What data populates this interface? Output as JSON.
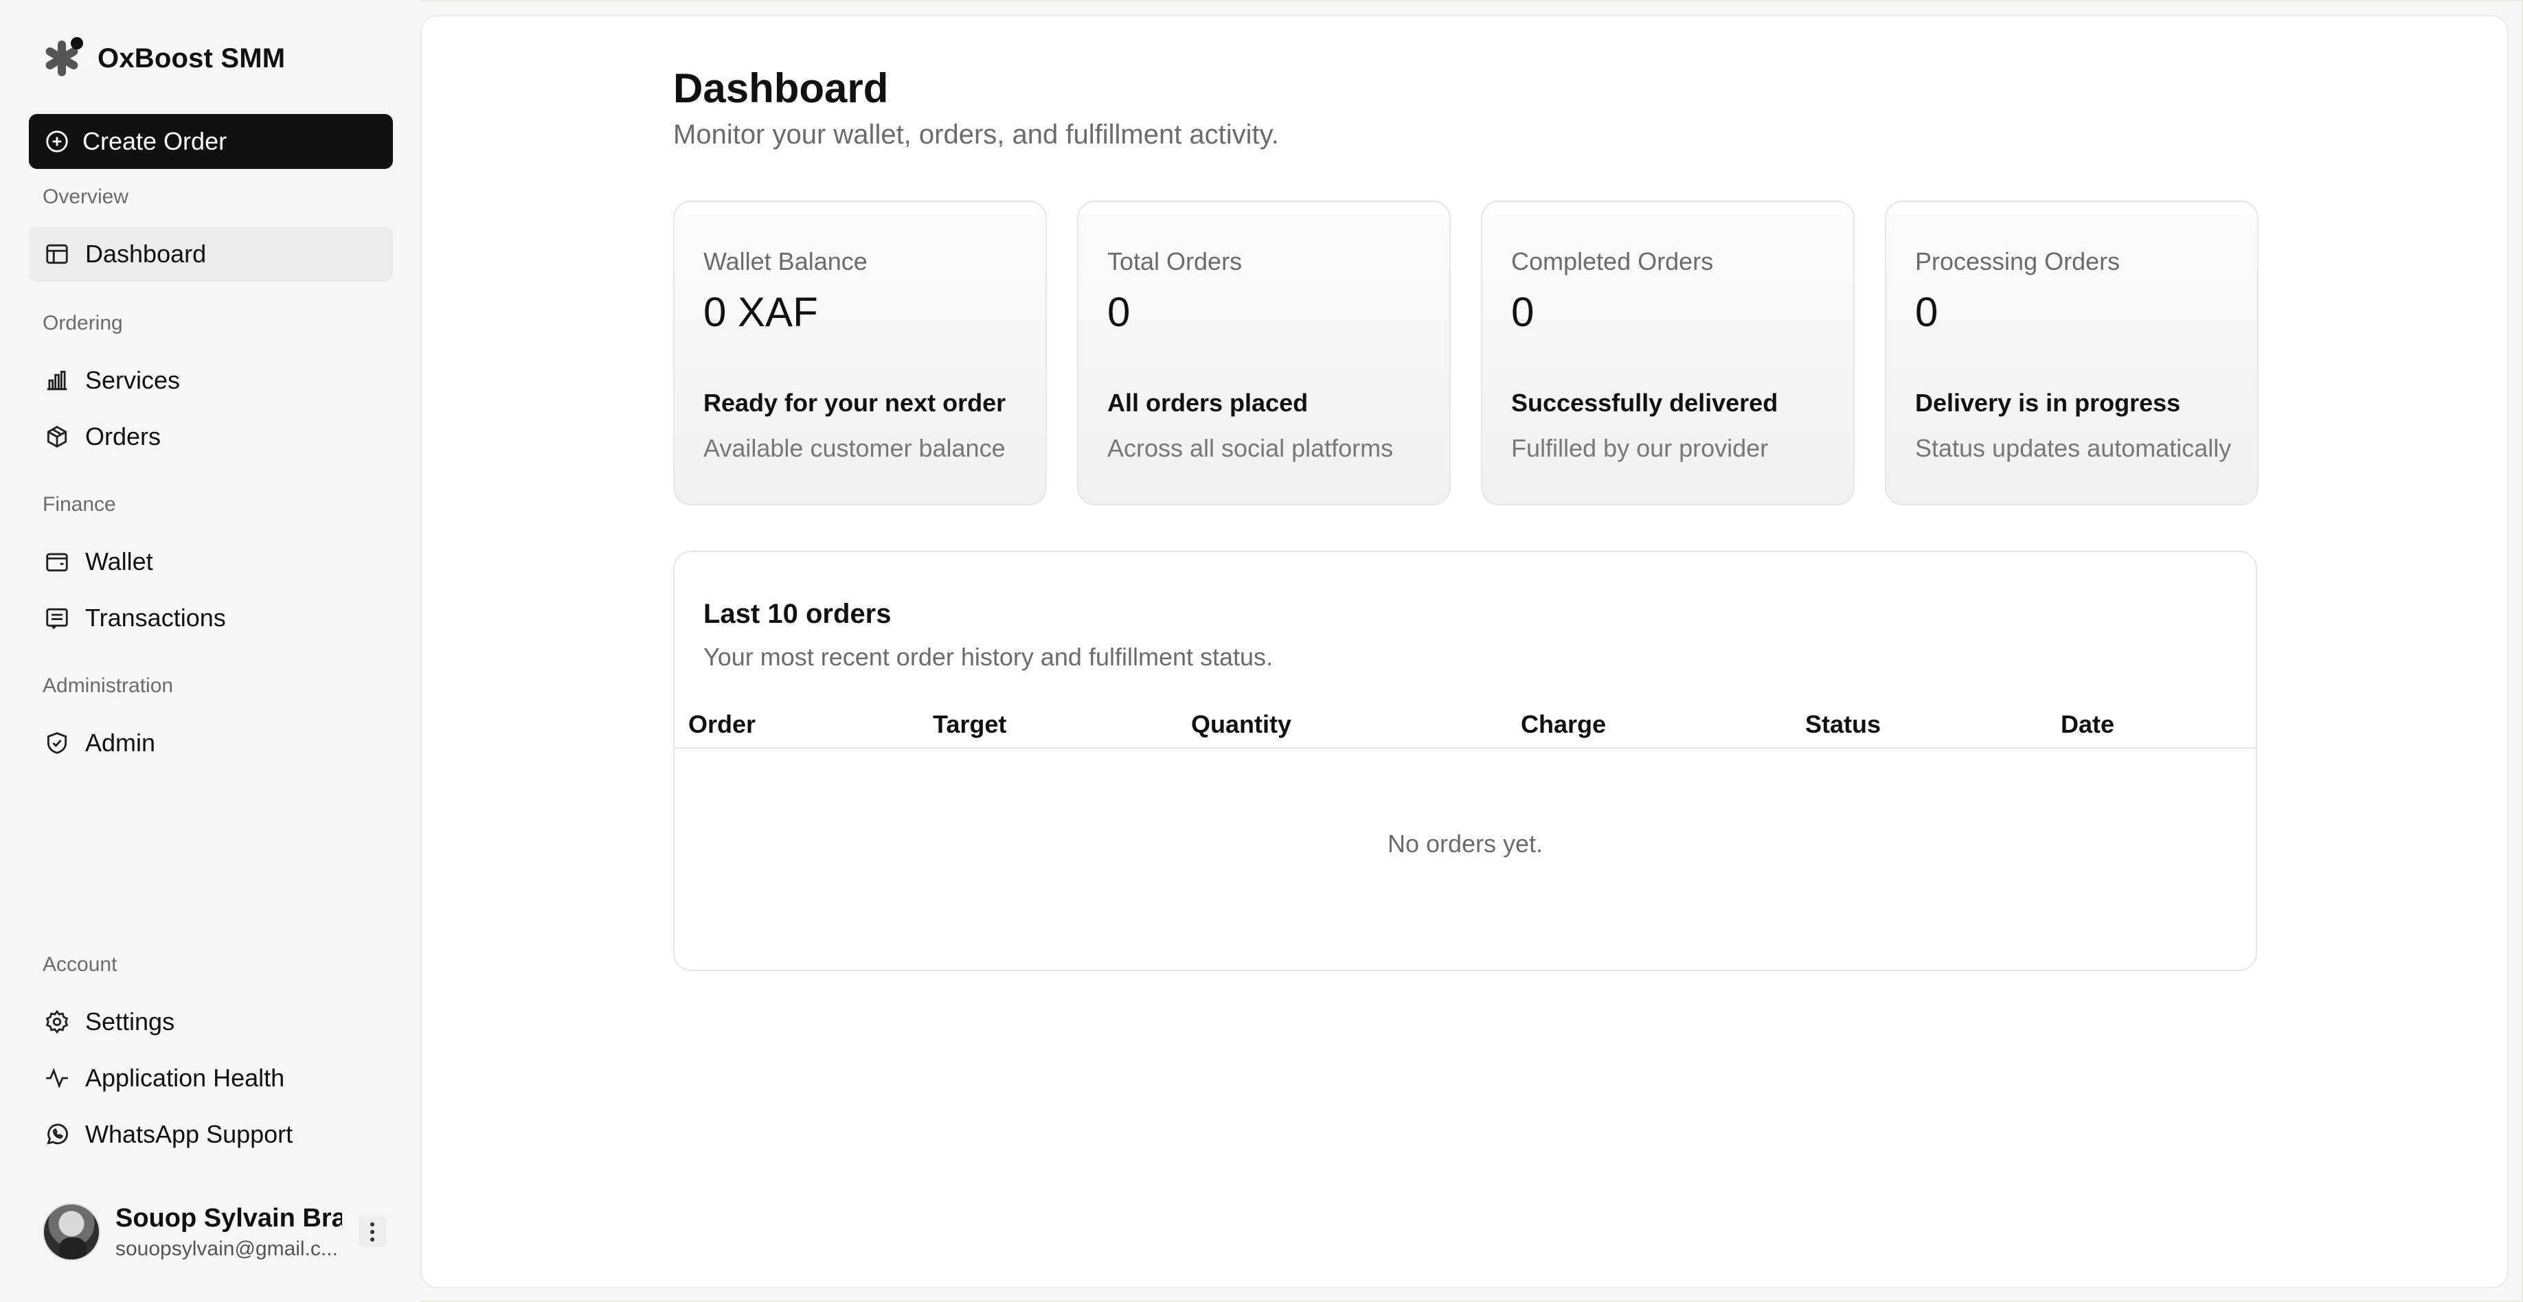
{
  "brand": {
    "name": "OxBoost SMM",
    "logo_icon": "asterisk-logo-icon"
  },
  "sidebar": {
    "create_order": {
      "label": "Create Order",
      "icon": "plus-circle-icon"
    },
    "sections": {
      "overview": "Overview",
      "ordering": "Ordering",
      "finance": "Finance",
      "administration": "Administration",
      "account": "Account"
    },
    "items": {
      "dashboard": {
        "label": "Dashboard",
        "icon": "layout-icon",
        "active": true
      },
      "services": {
        "label": "Services",
        "icon": "bar-chart-icon"
      },
      "orders": {
        "label": "Orders",
        "icon": "package-icon"
      },
      "wallet": {
        "label": "Wallet",
        "icon": "wallet-icon"
      },
      "transactions": {
        "label": "Transactions",
        "icon": "receipt-icon"
      },
      "admin": {
        "label": "Admin",
        "icon": "shield-check-icon"
      },
      "settings": {
        "label": "Settings",
        "icon": "gear-icon"
      },
      "health": {
        "label": "Application Health",
        "icon": "activity-icon"
      },
      "whatsapp": {
        "label": "WhatsApp Support",
        "icon": "whatsapp-icon"
      }
    },
    "user": {
      "name": "Souop Sylvain Bra...",
      "email": "souopsylvain@gmail.c..."
    }
  },
  "main": {
    "title": "Dashboard",
    "subtitle": "Monitor your wallet, orders, and fulfillment activity.",
    "cards": [
      {
        "label": "Wallet Balance",
        "value": "0 XAF",
        "headline": "Ready for your next order",
        "desc": "Available customer balance"
      },
      {
        "label": "Total Orders",
        "value": "0",
        "headline": "All orders placed",
        "desc": "Across all social platforms"
      },
      {
        "label": "Completed Orders",
        "value": "0",
        "headline": "Successfully delivered",
        "desc": "Fulfilled by our provider"
      },
      {
        "label": "Processing Orders",
        "value": "0",
        "headline": "Delivery is in progress",
        "desc": "Status updates automatically"
      }
    ],
    "orders": {
      "title": "Last 10 orders",
      "subtitle": "Your most recent order history and fulfillment status.",
      "columns": [
        "Order",
        "Target",
        "Quantity",
        "Charge",
        "Status",
        "Date"
      ],
      "empty": "No orders yet."
    }
  },
  "colors": {
    "primary": "#111111",
    "muted": "#6b6b6b",
    "sidebar_bg": "#f6f6f6",
    "active_bg": "#ececec"
  }
}
